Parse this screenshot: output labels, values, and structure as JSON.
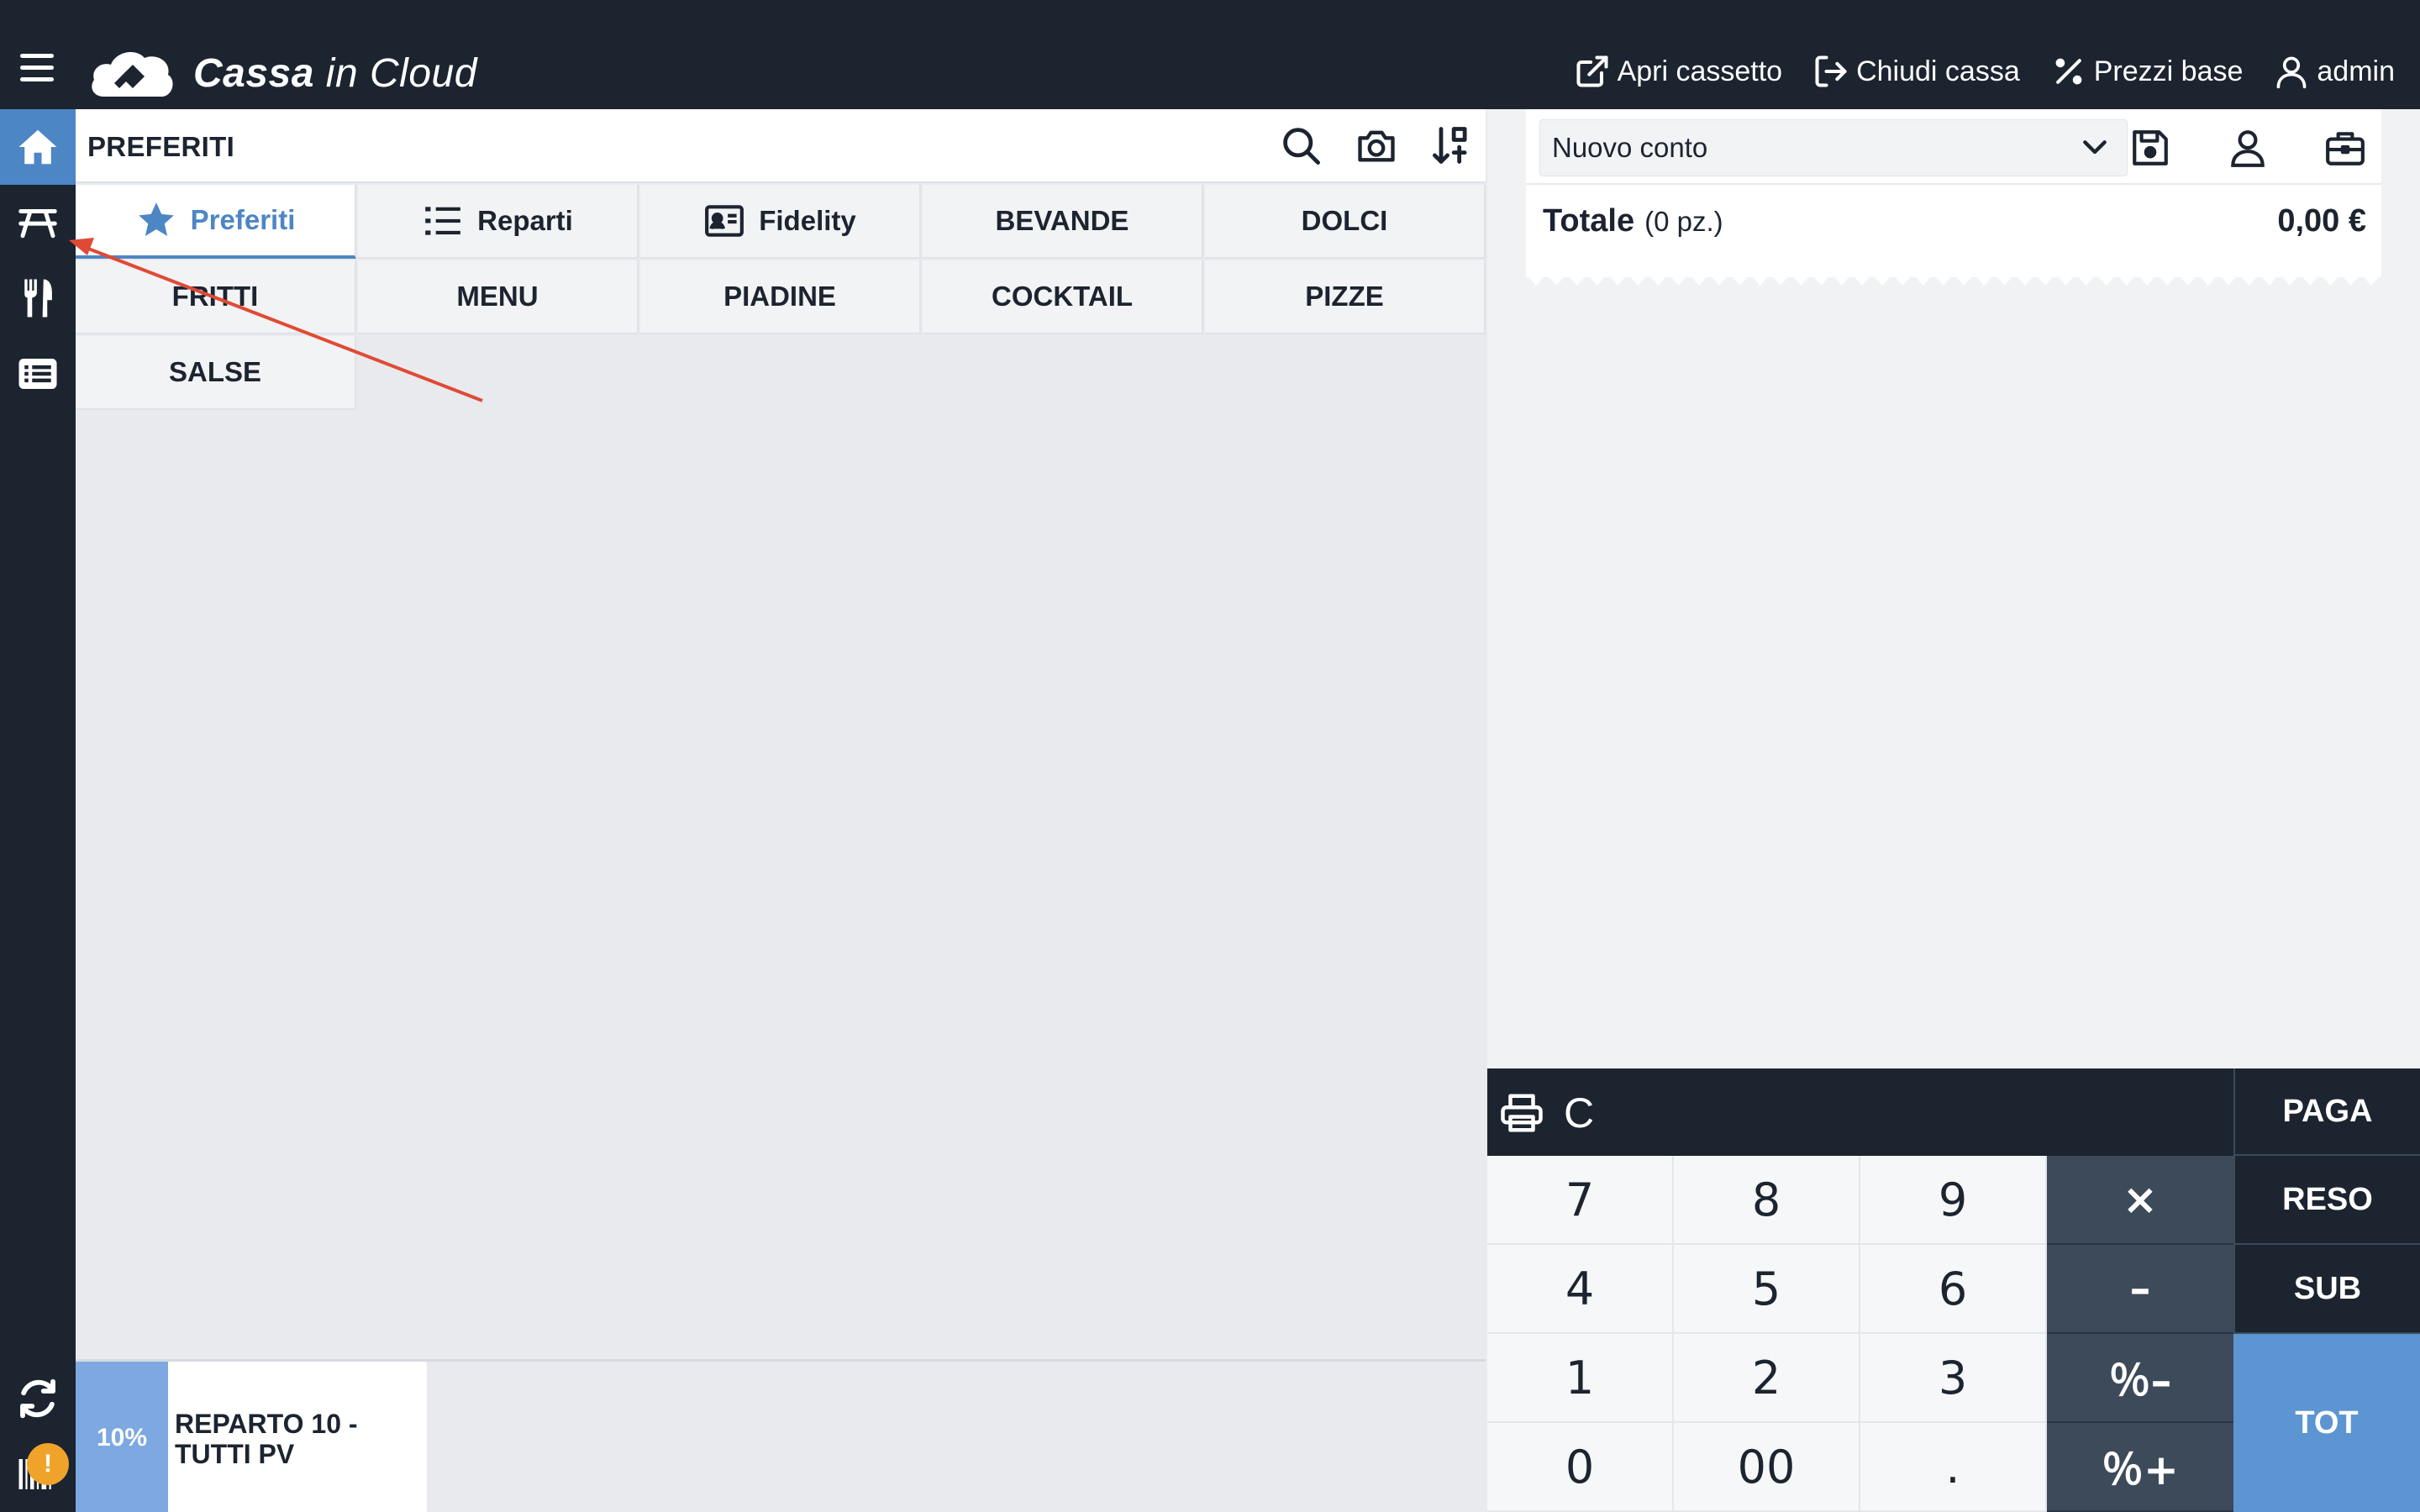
{
  "app": {
    "name_bold": "Cassa",
    "name_light": " in Cloud"
  },
  "topbar": {
    "actions": [
      {
        "label": "Apri cassetto",
        "icon": "external-link-icon"
      },
      {
        "label": "Chiudi cassa",
        "icon": "sign-out-icon"
      },
      {
        "label": "Prezzi base",
        "icon": "percent-slash-icon"
      },
      {
        "label": "admin",
        "icon": "user-icon"
      }
    ]
  },
  "sidebar": {
    "items": [
      {
        "icon": "home-icon",
        "active": true
      },
      {
        "icon": "picnic-table-icon",
        "active": false
      },
      {
        "icon": "fork-knife-icon",
        "active": false
      },
      {
        "icon": "list-icon",
        "active": false
      }
    ],
    "bottom": [
      {
        "icon": "sync-icon"
      },
      {
        "icon": "barcode-icon",
        "badge": "!"
      }
    ]
  },
  "products": {
    "title": "PREFERITI",
    "header_icons": [
      "search-icon",
      "camera-icon",
      "sort-icon"
    ],
    "categories": [
      {
        "label": "Preferiti",
        "icon": "star-icon",
        "active": true
      },
      {
        "label": "Reparti",
        "icon": "list-icon",
        "active": false
      },
      {
        "label": "Fidelity",
        "icon": "id-card-icon",
        "active": false
      },
      {
        "label": "BEVANDE"
      },
      {
        "label": "DOLCI"
      },
      {
        "label": "FRITTI"
      },
      {
        "label": "MENU"
      },
      {
        "label": "PIADINE"
      },
      {
        "label": "COCKTAIL"
      },
      {
        "label": "PIZZE"
      },
      {
        "label": "SALSE"
      }
    ]
  },
  "bottom_strip": {
    "reparto": {
      "percent": "10%",
      "name": "REPARTO 10 - TUTTI PV"
    }
  },
  "receipt": {
    "conto_select": "Nuovo conto",
    "icons": [
      "save-icon",
      "customer-icon",
      "briefcase-icon"
    ],
    "totale_label": "Totale",
    "totale_pz": "(0 pz.)",
    "totale_amount": "0,00 €"
  },
  "keypad": {
    "top_icons": [
      "printer-icon",
      "clear-icon"
    ],
    "clear_label": "C",
    "numbers": [
      "7",
      "8",
      "9",
      "4",
      "5",
      "6",
      "1",
      "2",
      "3",
      "0",
      "00",
      "."
    ],
    "ops": {
      "multiply": "×",
      "minus": "–",
      "pct_minus": "％–",
      "pct_plus": "％+"
    },
    "actions": {
      "paga": "PAGA",
      "reso": "RESO",
      "sub": "SUB",
      "tot": "TOT"
    }
  },
  "colors": {
    "dark": "#1c2430",
    "accent": "#4d86c4",
    "tot": "#5c95d1",
    "op_key": "#3d4a5a",
    "annotation_arrow": "#e04a35"
  }
}
